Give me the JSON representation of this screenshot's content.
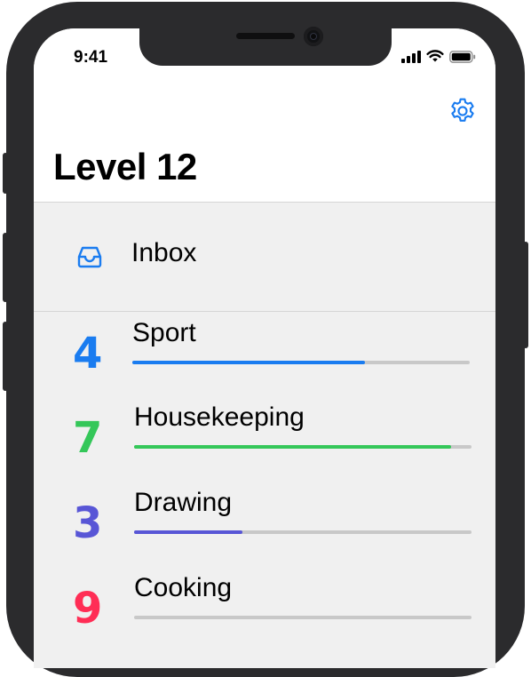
{
  "status": {
    "time": "9:41"
  },
  "header": {
    "title": "Level 12"
  },
  "inbox": {
    "label": "Inbox",
    "color": "#1a7cf0"
  },
  "categories": [
    {
      "count": "4",
      "name": "Sport",
      "color": "#1a7cf0",
      "progress": 0.69
    },
    {
      "count": "7",
      "name": "Housekeeping",
      "color": "#34c759",
      "progress": 0.94
    },
    {
      "count": "3",
      "name": "Drawing",
      "color": "#5856d6",
      "progress": 0.32
    },
    {
      "count": "9",
      "name": "Cooking",
      "color": "#ff2d55",
      "progress": 0.0
    }
  ],
  "icons": {
    "settings": "gear-icon",
    "inbox": "inbox-tray-icon"
  },
  "accent": "#1a7cf0"
}
